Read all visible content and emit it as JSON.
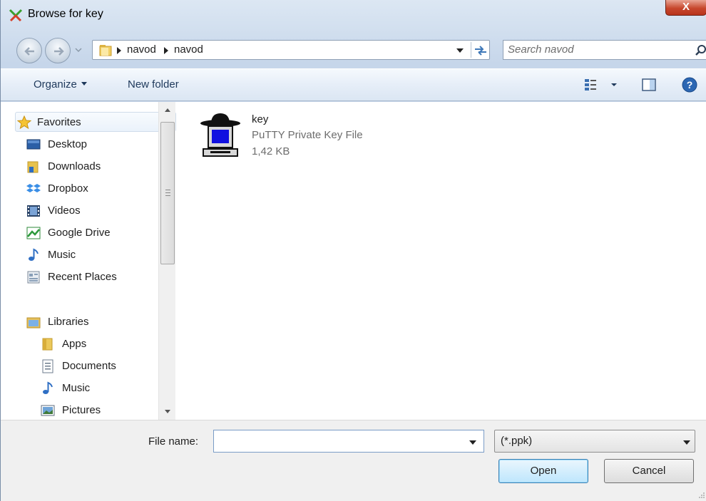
{
  "window": {
    "title": "Browse for key",
    "close_label": "X"
  },
  "address_bar": {
    "breadcrumbs": [
      "navod",
      "navod"
    ],
    "search_placeholder": "Search navod"
  },
  "toolbar": {
    "organize_label": "Organize",
    "new_folder_label": "New folder"
  },
  "nav_pane": {
    "favorites_header": "Favorites",
    "favorites": [
      "Desktop",
      "Downloads",
      "Dropbox",
      "Videos",
      "Google Drive",
      "Music",
      "Recent Places"
    ],
    "libraries_header": "Libraries",
    "libraries": [
      "Apps",
      "Documents",
      "Music",
      "Pictures"
    ]
  },
  "files": [
    {
      "name": "key",
      "type": "PuTTY Private Key File",
      "size": "1,42 KB"
    }
  ],
  "bottom": {
    "file_name_label": "File name:",
    "file_name_value": "",
    "filter_value": "(*.ppk)",
    "open_label": "Open",
    "cancel_label": "Cancel"
  },
  "colors": {
    "accent": "#3c7fb1",
    "close_red": "#c7472d",
    "link_text": "#1e395b"
  }
}
